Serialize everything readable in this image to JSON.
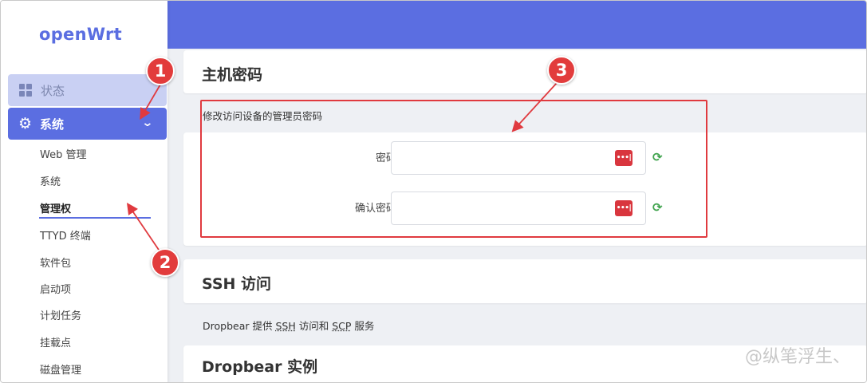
{
  "sidebar": {
    "logo": "openWrt",
    "status_label": "状态",
    "system_label": "系统",
    "sub_items": [
      "Web 管理",
      "系统",
      "管理权",
      "TTYD 终端",
      "软件包",
      "启动项",
      "计划任务",
      "挂载点",
      "磁盘管理"
    ],
    "active_sub_index": 2
  },
  "main": {
    "host_password": {
      "title": "主机密码",
      "description": "修改访问设备的管理员密码",
      "password_label": "密码",
      "password_value": "",
      "confirm_label": "确认密码",
      "confirm_value": "",
      "reveal_icon_text": "•••|"
    },
    "ssh": {
      "title": "SSH 访问",
      "description_parts": [
        "Dropbear 提供 ",
        "SSH",
        " 访问和 ",
        "SCP",
        " 服务"
      ]
    },
    "dropbear": {
      "title": "Dropbear 实例"
    }
  },
  "annotations": {
    "badges": [
      "1",
      "2",
      "3"
    ],
    "color": "#e03a3f"
  },
  "watermark": "@纵笔浮生、",
  "colors": {
    "accent": "#5b6ee1",
    "status_bg": "#c9d0f3",
    "danger": "#d9363e",
    "refresh": "#3fa34d"
  },
  "icons": {
    "status": "dashboard-grid-icon",
    "system": "gear-icon",
    "expand": "chevron-down-icon",
    "reveal": "password-reveal-icon",
    "regenerate": "refresh-icon"
  }
}
